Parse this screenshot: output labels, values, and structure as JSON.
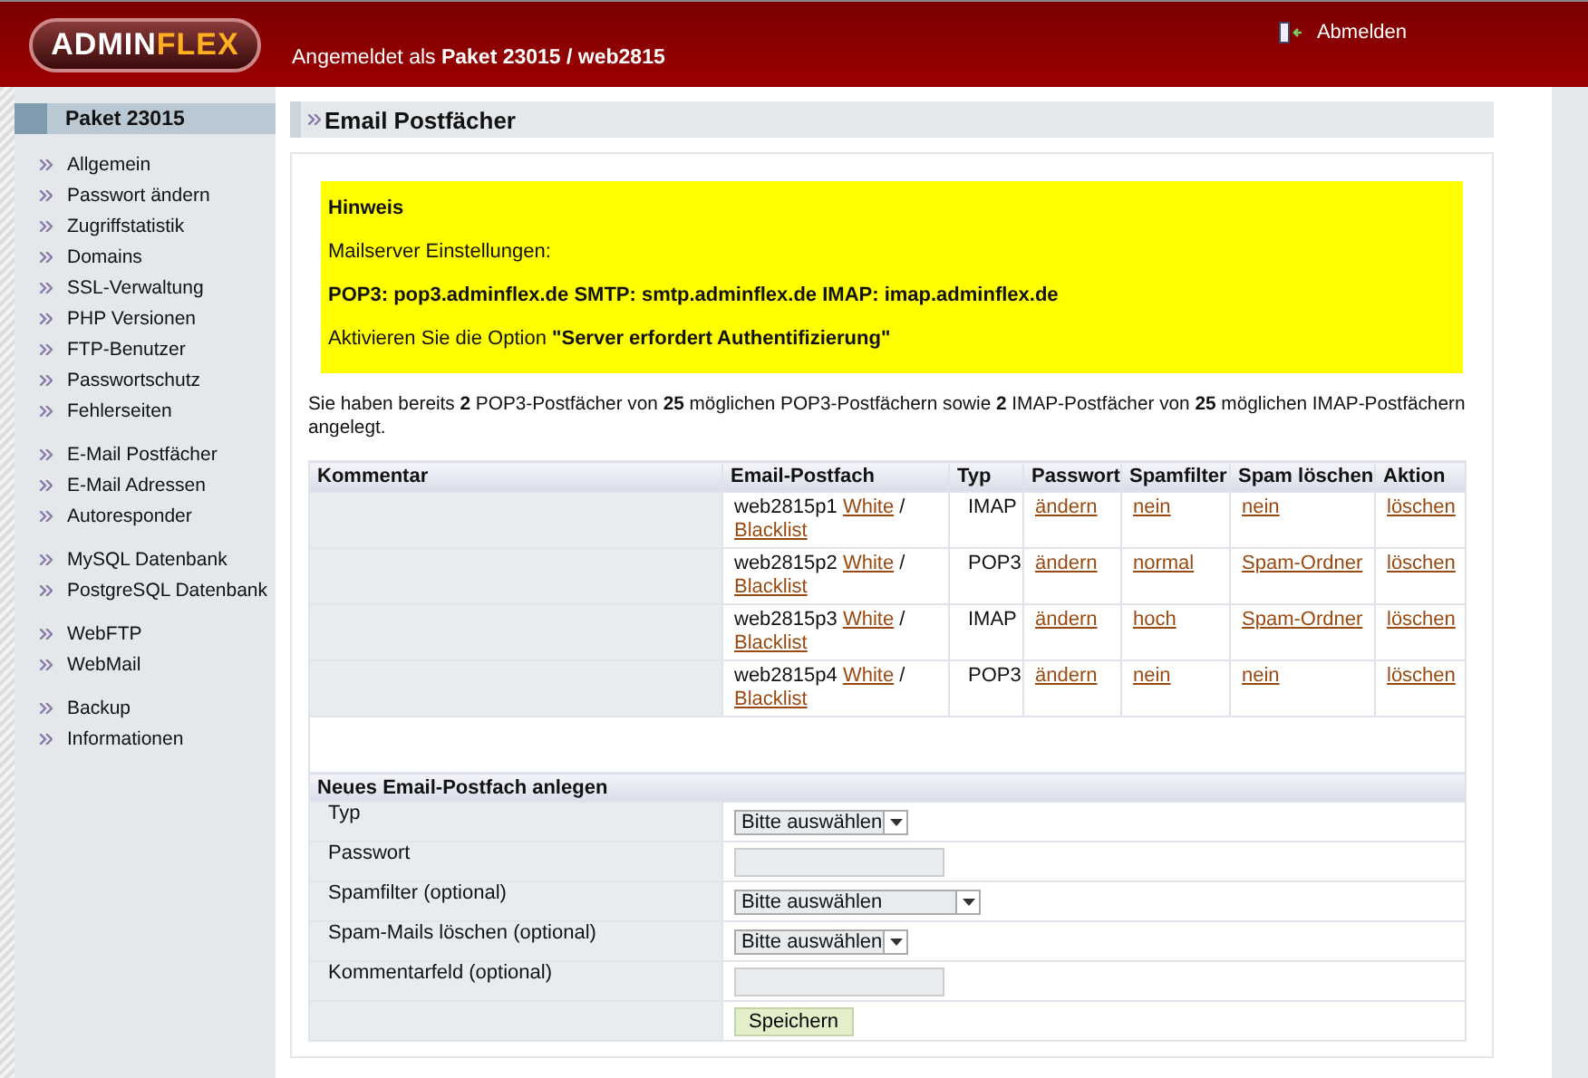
{
  "header": {
    "logo": {
      "first": "ADMIN",
      "second": "FLEX"
    },
    "user": "Angemeldet als **Paket 23015 / web2815**",
    "logout": "Abmelden"
  },
  "sidebar": {
    "title": "Paket 23015",
    "groups": [
      {
        "items": [
          {
            "label": "Allgemein"
          },
          {
            "label": "Passwort ändern"
          },
          {
            "label": "Zugriffstatistik"
          },
          {
            "label": "Domains"
          },
          {
            "label": "SSL-Verwaltung"
          },
          {
            "label": "PHP Versionen"
          },
          {
            "label": "FTP-Benutzer"
          },
          {
            "label": "Passwortschutz"
          },
          {
            "label": "Fehlerseiten"
          }
        ]
      },
      {
        "items": [
          {
            "label": "E-Mail Postfächer"
          },
          {
            "label": "E-Mail Adressen"
          },
          {
            "label": "Autoresponder"
          }
        ]
      },
      {
        "items": [
          {
            "label": "MySQL Datenbank"
          },
          {
            "label": "PostgreSQL Datenbank"
          }
        ]
      },
      {
        "items": [
          {
            "label": "WebFTP"
          },
          {
            "label": "WebMail"
          }
        ]
      },
      {
        "items": [
          {
            "label": "Backup"
          },
          {
            "label": "Informationen"
          }
        ]
      }
    ]
  },
  "page": {
    "title": "Email Postfächer",
    "notice": {
      "title": "Hinweis",
      "lines": [
        "Mailserver Einstellungen:",
        "**POP3: pop3.adminflex.de SMTP: smtp.adminflex.de IMAP: imap.adminflex.de**",
        "Aktivieren Sie die Option **\"Server erfordert Authentifizierung\"**"
      ]
    },
    "summary": "Sie haben bereits **2** POP3-Postfächer von **25** möglichen POP3-Postfächern sowie **2** IMAP-Postfächer von **25** möglichen IMAP-Postfächern angelegt.",
    "table": {
      "columns": [
        "Kommentar",
        "Email-Postfach",
        "Typ",
        "Passwort",
        "Spamfilter",
        "Spam löschen",
        "Aktion"
      ],
      "rows": [
        {
          "mailbox": "web2815p1",
          "white": "White",
          "separator": "/",
          "black": "Blacklist",
          "type": "IMAP",
          "password": "ändern",
          "spamfilter": "nein",
          "spam_delete": "nein",
          "action": "löschen"
        },
        {
          "mailbox": "web2815p2",
          "white": "White",
          "separator": "/",
          "black": "Blacklist",
          "type": "POP3",
          "password": "ändern",
          "spamfilter": "normal",
          "spam_delete": "Spam-Ordner",
          "action": "löschen"
        },
        {
          "mailbox": "web2815p3",
          "white": "White",
          "separator": "/",
          "black": "Blacklist",
          "type": "IMAP",
          "password": "ändern",
          "spamfilter": "hoch",
          "spam_delete": "Spam-Ordner",
          "action": "löschen"
        },
        {
          "mailbox": "web2815p4",
          "white": "White",
          "separator": "/",
          "black": "Blacklist",
          "type": "POP3",
          "password": "ändern",
          "spamfilter": "nein",
          "spam_delete": "nein",
          "action": "löschen"
        }
      ]
    },
    "form": {
      "title": "Neues Email-Postfach anlegen",
      "rows": [
        {
          "kind": "select",
          "label": "Typ",
          "value": "Bitte auswählen"
        },
        {
          "kind": "input",
          "label": "Passwort"
        },
        {
          "kind": "wide-select",
          "label": "Spamfilter (optional)",
          "value": "Bitte auswählen"
        },
        {
          "kind": "select",
          "label": "Spam-Mails löschen (optional)",
          "value": "Bitte auswählen"
        },
        {
          "kind": "input",
          "label": "Kommentarfeld (optional)"
        },
        {
          "kind": "button",
          "value": "Speichern"
        }
      ]
    }
  }
}
